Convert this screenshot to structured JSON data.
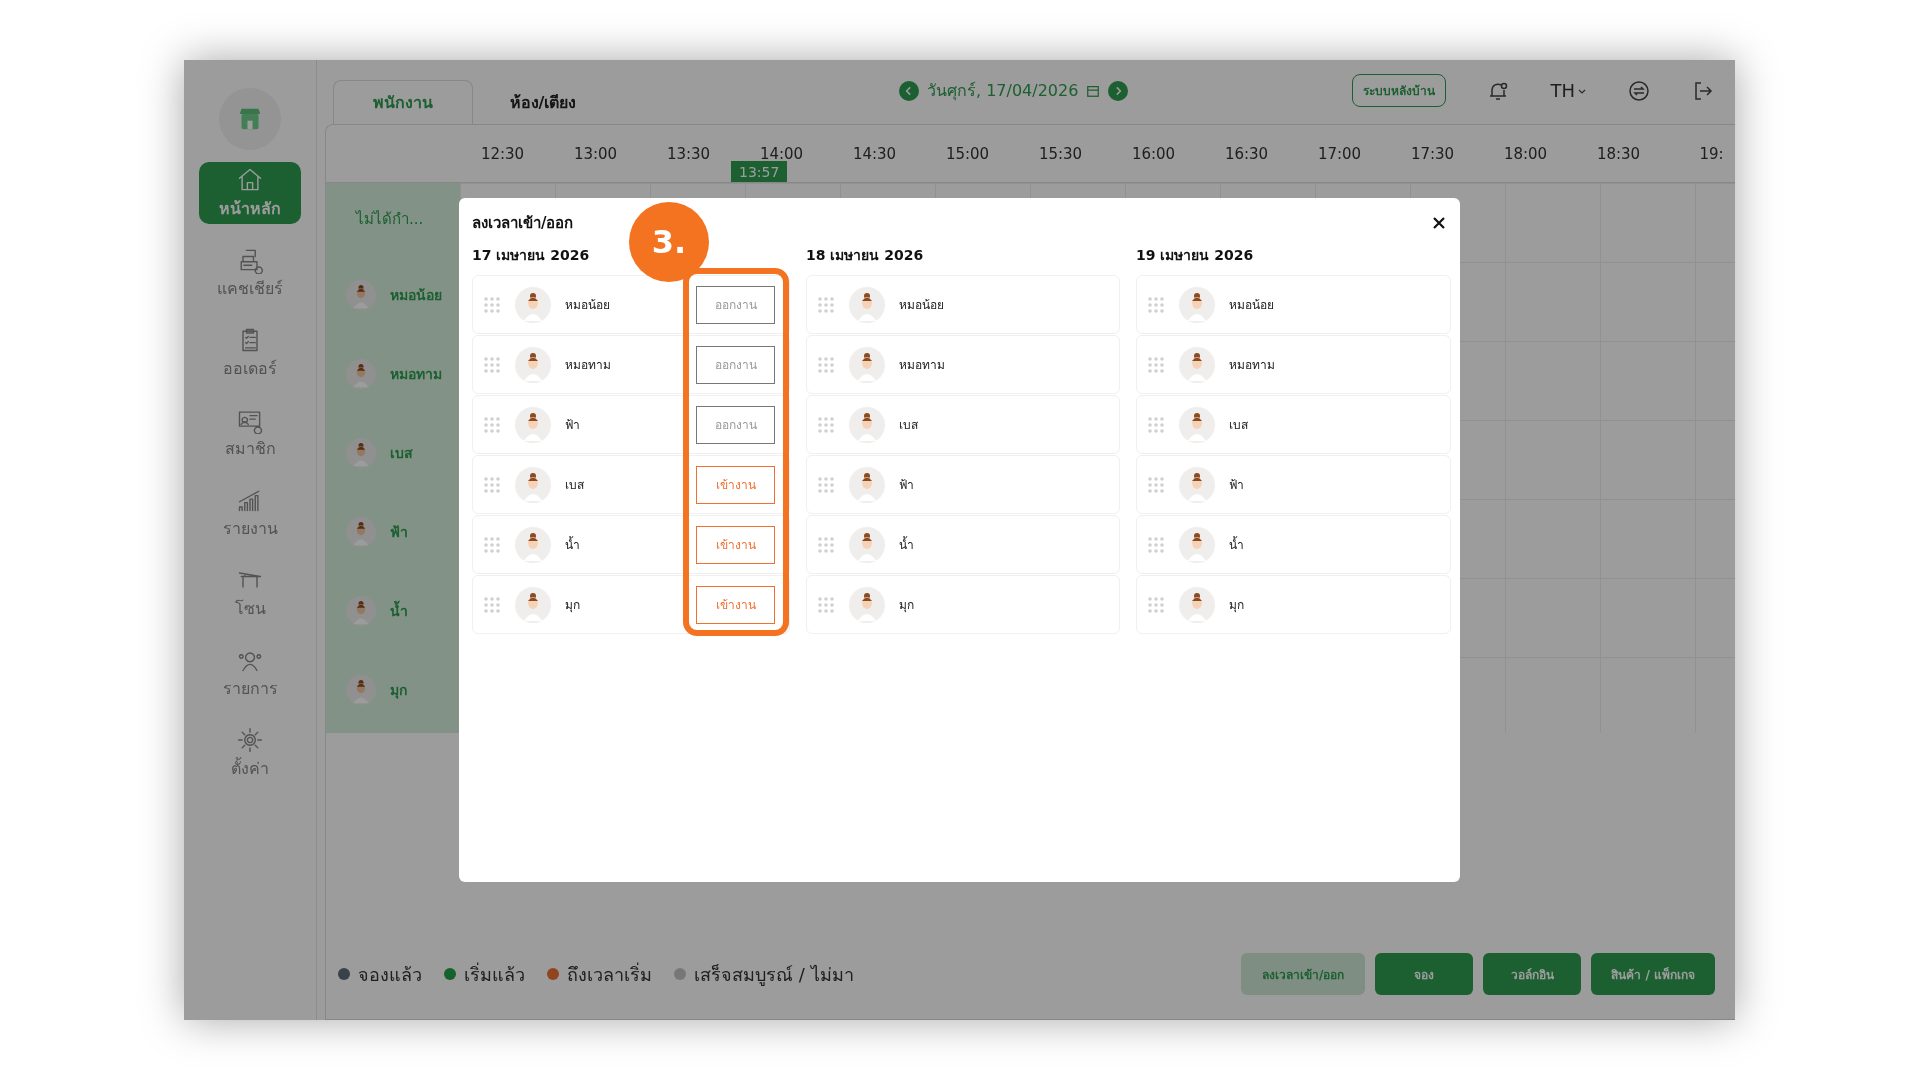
{
  "sidebar": {
    "items": [
      {
        "label": "หน้าหลัก",
        "selected": true
      },
      {
        "label": "แคชเชียร์",
        "selected": false
      },
      {
        "label": "ออเดอร์",
        "selected": false
      },
      {
        "label": "สมาชิก",
        "selected": false
      },
      {
        "label": "รายงาน",
        "selected": false
      },
      {
        "label": "โซน",
        "selected": false
      },
      {
        "label": "รายการ",
        "selected": false
      },
      {
        "label": "ตั้งค่า",
        "selected": false
      }
    ]
  },
  "tabs": [
    {
      "label": "พนักงาน",
      "selected": true
    },
    {
      "label": "ห้อง/เตียง",
      "selected": false
    }
  ],
  "date": "วันศุกร์, 17/04/2026",
  "backoffice_button": "ระบบหลังบ้าน",
  "language": "TH",
  "timeline": {
    "times": [
      "12:30",
      "13:00",
      "13:30",
      "14:00",
      "14:30",
      "15:00",
      "15:30",
      "16:00",
      "16:30",
      "17:00",
      "17:30",
      "18:00",
      "18:30",
      "19:"
    ],
    "now": "13:57"
  },
  "staff_column": {
    "header": "ไม่ได้กำ...",
    "staff": [
      "หมอน้อย",
      "หมอทาม",
      "เบส",
      "ฟ้า",
      "น้ำ",
      "มุก"
    ]
  },
  "legend": [
    {
      "label": "จองแล้ว",
      "color": "#39414a"
    },
    {
      "label": "เริ่มแล้ว",
      "color": "#15622d"
    },
    {
      "label": "ถึงเวลาเริ่ม",
      "color": "#92441d"
    },
    {
      "label": "เสร็จสมบูรณ์ / ไม่มา",
      "color": "#777777"
    }
  ],
  "actions": [
    {
      "label": "ลงเวลาเข้า/ออก",
      "kind": "light"
    },
    {
      "label": "จอง",
      "kind": "solid"
    },
    {
      "label": "วอล์กอิน",
      "kind": "solid"
    },
    {
      "label": "สินค้า / แพ็กเกจ",
      "kind": "solid"
    }
  ],
  "dialog": {
    "title": "ลงเวลาเข้า/ออก",
    "days": [
      {
        "date": "17 เมษายน 2026",
        "staff": [
          {
            "name": "หมอน้อย",
            "action": {
              "label": "ออกงาน",
              "kind": "out"
            }
          },
          {
            "name": "หมอทาม",
            "action": {
              "label": "ออกงาน",
              "kind": "out"
            }
          },
          {
            "name": "ฟ้า",
            "action": {
              "label": "ออกงาน",
              "kind": "out"
            }
          },
          {
            "name": "เบส",
            "action": {
              "label": "เข้างาน",
              "kind": "in"
            }
          },
          {
            "name": "น้ำ",
            "action": {
              "label": "เข้างาน",
              "kind": "in"
            }
          },
          {
            "name": "มุก",
            "action": {
              "label": "เข้างาน",
              "kind": "in"
            }
          }
        ]
      },
      {
        "date": "18 เมษายน 2026",
        "staff": [
          {
            "name": "หมอน้อย"
          },
          {
            "name": "หมอทาม"
          },
          {
            "name": "เบส"
          },
          {
            "name": "ฟ้า"
          },
          {
            "name": "น้ำ"
          },
          {
            "name": "มุก"
          }
        ]
      },
      {
        "date": "19 เมษายน 2026",
        "staff": [
          {
            "name": "หมอน้อย"
          },
          {
            "name": "หมอทาม"
          },
          {
            "name": "เบส"
          },
          {
            "name": "ฟ้า"
          },
          {
            "name": "น้ำ"
          },
          {
            "name": "มุก"
          }
        ]
      }
    ]
  },
  "annotation": {
    "label": "3."
  }
}
